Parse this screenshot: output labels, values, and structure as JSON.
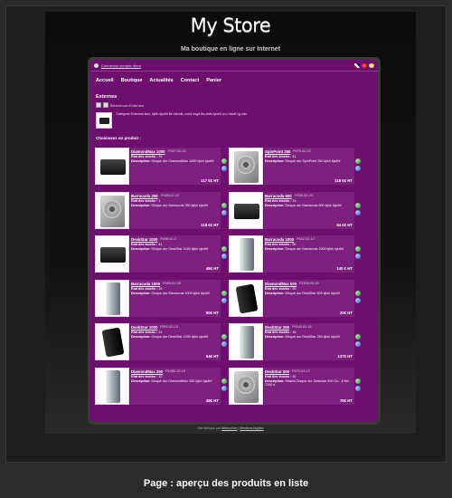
{
  "store": {
    "title": "My Store",
    "subtitle": "Ma boutique en ligne sur Internet"
  },
  "topbar": {
    "login_link": "Connexion compte client"
  },
  "nav": [
    "Accueil",
    "Boutique",
    "Actualités",
    "Contact",
    "Panier"
  ],
  "section": {
    "title": "Externes",
    "breadcrumb": "Bienvenue>Externes",
    "category_text": "Catégorie Externes klsx, kjhlh kjsdhf klh klkmkl, nokd hsgd fhs,dnfs kjsdhf vn,n fsvdf vg nds",
    "choose_label": "Choisissez un produit :"
  },
  "labels": {
    "stock": "Etat des stocks :",
    "description": "Description:"
  },
  "products": [
    {
      "name": "DiamondMax 1000",
      "ref": "P327-02-21",
      "stock": "39",
      "desc": "Disque dur DiamondMax 1000 kjlsh kjsdhf",
      "price": "117 €€  HT",
      "shape": "ext"
    },
    {
      "name": "SpinPoint 250",
      "ref": "P470-02-22",
      "stock": "41",
      "desc": "Disque dur SpinPoint 250 kjlsh kjsdhf",
      "price": "118 €€  HT",
      "shape": "hdd"
    },
    {
      "name": "Barracuda 250",
      "ref": "P345-02-23",
      "stock": "1",
      "desc": "Disque dur Barracuda 250 kjlsh kjsdhf",
      "price": "118 €€  HT",
      "shape": "hdd"
    },
    {
      "name": "Barracuda 500",
      "ref": "P336-02-24",
      "stock": "13",
      "desc": "Disque dur Barracuda 500 kjlsh kjsdhf",
      "price": "64 €€  HT",
      "shape": "ext"
    },
    {
      "name": "DeskStar 1000",
      "ref": "P496-02-2",
      "stock": "41",
      "desc": "Disque dur DeskStar 1000 kjlsh kjsdhf",
      "price": "48€  HT",
      "shape": "ext"
    },
    {
      "name": "Barracuda 1000",
      "ref": "P162-02-12",
      "stock": "50",
      "desc": "Disque dur Barracuda 1000 kjlsh kjsdhf",
      "price": "140 €  HT",
      "shape": "tower"
    },
    {
      "name": "Barracuda 1000",
      "ref": "P369-02-25",
      "stock": "15",
      "desc": "Disque dur Barracuda 1000 kjlsh kjsdhf",
      "price": "90€  HT",
      "shape": "tower"
    },
    {
      "name": "DiamondMax 500",
      "ref": "P1105-02-20",
      "stock": "39",
      "desc": "Disque dur DeskStar 500 kjlsh kjsdhf",
      "price": "20€  HT",
      "shape": "black"
    },
    {
      "name": "DeskStar 1000",
      "ref": "P901-02-15",
      "stock": "21",
      "desc": "Disque dur DeskStar 1000 kjlsh kjsdhf",
      "price": "54€  HT",
      "shape": "black"
    },
    {
      "name": "DeskStar 250",
      "ref": "P1140-02-16",
      "stock": "16",
      "desc": "Disque dur DeskStar 250 kjlsh kjsdhf",
      "price": "137€  HT",
      "shape": "tower"
    },
    {
      "name": "DiamondMax 250",
      "ref": "P1490-02-19",
      "stock": "12",
      "desc": "Disque dur DiamondMax 250 kjlsh kjsdhf",
      "price": "48€  HT",
      "shape": "tower"
    },
    {
      "name": "DeskStar 500",
      "ref": "P470-03-17",
      "stock": "32",
      "desc": "Hitachi Disque dur Deskstar 500 Go - 8 Mo - 7200 tr",
      "price": "78€  HT",
      "shape": "hdd"
    }
  ],
  "footer": {
    "text": "Site fabriqué par",
    "author1": "WebsoGen",
    "sep": " | ",
    "author2": "Mentions légales"
  },
  "caption": "Page : aperçu des produits en liste",
  "colors": {
    "accent": "#6e0f70",
    "card": "#7d2080",
    "background": "#2b2b2b"
  }
}
